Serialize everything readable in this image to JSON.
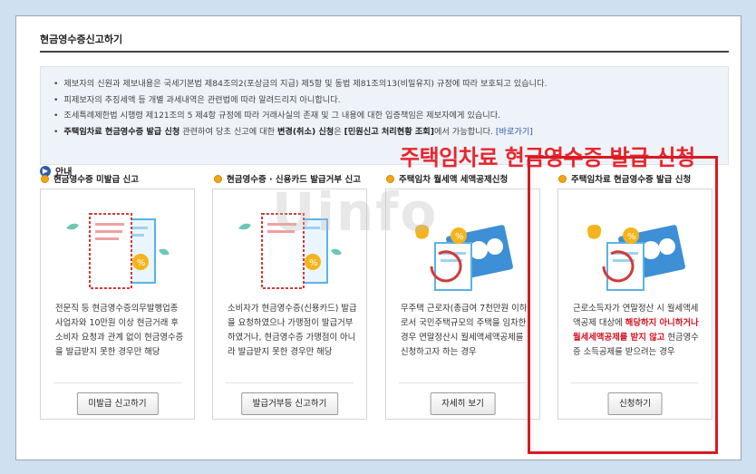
{
  "page_title": "현금영수증신고하기",
  "notice": {
    "items": [
      "제보자의 신원과 제보내용은 국세기본법 제84조의2(포상금의 지급) 제5항 및 동법 제81조의13(비밀유지) 규정에 따라 보호되고 있습니다.",
      "피제보자의 추징세액 등 개별 과세내역은 관련법에 따라 알려드리지 아니합니다.",
      "조세특례제한법 시행령 제121조의 5 제4항 규정에 따라 거래사실의 존재 및 그 내용에 대한 입증책임은 제보자에게 있습니다."
    ],
    "last": {
      "part1": "주택임차료 현금영수증 발급 신청",
      "part2": " 관련하여 당초 신고에 대한 ",
      "part3": "변경(취소) 신청",
      "part4": "은 ",
      "part5": "[민원신고 처리현황 조회]",
      "part6": "에서 가능합니다. ",
      "link": "[바로가기]"
    }
  },
  "annotation": "주택임차료 현금영수증 발급 신청",
  "guide_label": "안내",
  "watermark": "Uinfo",
  "cards": [
    {
      "title": "현금영수증 미발급 신고",
      "desc": "전문직 등 현금영수증의무발행업종 사업자와 10만원 이상 현금거래 후 소비자 요청과 관계 없이 현금영수증을 발급받지 못한 경우만 해당",
      "button": "미발급 신고하기"
    },
    {
      "title": "현금영수증 · 신용카드 발급거부 신고",
      "desc": "소비자가 현금영수증(신용카드) 발급을 요청하였으나 가맹점이 발급거부 하였거나, 현금영수증 가맹점이 아니라 발급받지 못한 경우만 해당",
      "button": "발급거부등 신고하기"
    },
    {
      "title": "주택임차 월세액 세액공제신청",
      "desc": "무주택 근로자(총급여 7천만원 이하)로서 국민주택규모의 주택을 임차한 경우 연말정산시 월세액세액공제를 신청하고자 하는 경우",
      "button": "자세히 보기"
    },
    {
      "title": "주택임차료 현금영수증 발급 신청",
      "desc_pre": "근로소득자가 연말정산 시 월세액세액공제 대상에 ",
      "desc_red": "해당하지 아니하거나 월세세액공제를 받지 않고",
      "desc_post": " 현금영수증 소득공제를 받으려는 경우",
      "button": "신청하기"
    }
  ],
  "colors": {
    "accent_red": "#e8262e",
    "guide_blue": "#2b5ea8",
    "bulb_orange": "#f2a516"
  }
}
